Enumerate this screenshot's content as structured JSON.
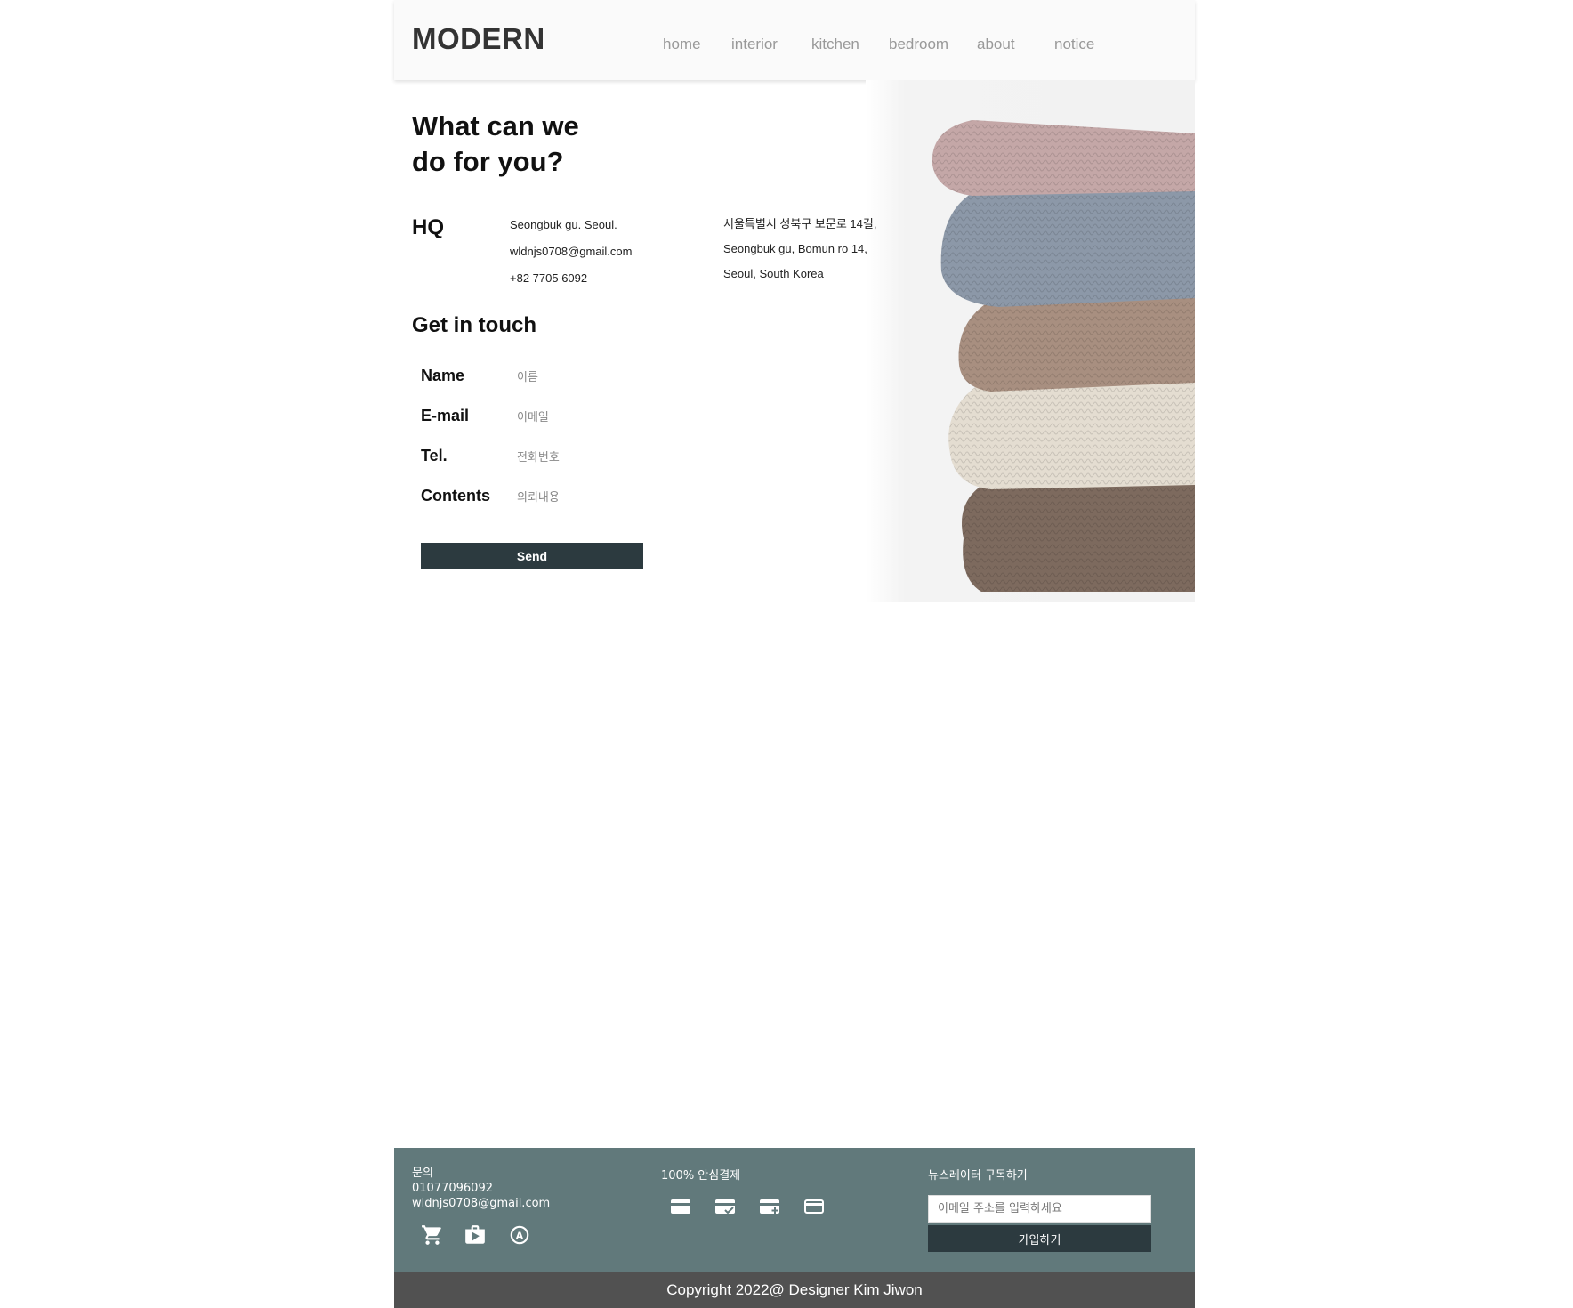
{
  "header": {
    "logo": "MODERN",
    "nav": [
      "home",
      "interior",
      "kitchen",
      "bedroom",
      "about",
      "notice"
    ]
  },
  "hero": {
    "title_line1": "What can we",
    "title_line2": "do for you?",
    "hq_label": "HQ",
    "hq_info": [
      "Seongbuk gu. Seoul.",
      "wldnjs0708@gmail.com",
      "+82 7705 6092"
    ],
    "hq_address": [
      "서울특별시 성북구 보문로 14길,",
      "Seongbuk gu, Bomun ro 14,",
      "Seoul, South Korea"
    ],
    "photo_icon": "knit-sweater-stack-photo"
  },
  "contact": {
    "heading": "Get in touch",
    "fields": [
      {
        "label": "Name",
        "placeholder": "이름"
      },
      {
        "label": "E-mail",
        "placeholder": "이메일"
      },
      {
        "label": "Tel.",
        "placeholder": "전화번호"
      },
      {
        "label": "Contents",
        "placeholder": "의뢰내용"
      }
    ],
    "send_label": "Send"
  },
  "footer": {
    "inquiry_title": "문의",
    "phone": "01077096092",
    "email": "wldnjs0708@gmail.com",
    "service_icons": [
      "cart-icon",
      "shop-bag-icon",
      "auto-renew-icon"
    ],
    "payment_title": "100% 안심결제",
    "payment_icons": [
      "credit-card-icon",
      "card-check-icon",
      "card-plus-icon",
      "card-outline-icon"
    ],
    "newsletter_title": "뉴스레이터 구독하기",
    "newsletter_placeholder": "이메일 주소를 입력하세요",
    "newsletter_button": "가입하기",
    "copyright": "Copyright 2022@ Designer Kim Jiwon",
    "colors": {
      "footer_bg": "#61797b",
      "copyright_bg": "#515151",
      "button_bg": "#2c3a3f"
    }
  }
}
